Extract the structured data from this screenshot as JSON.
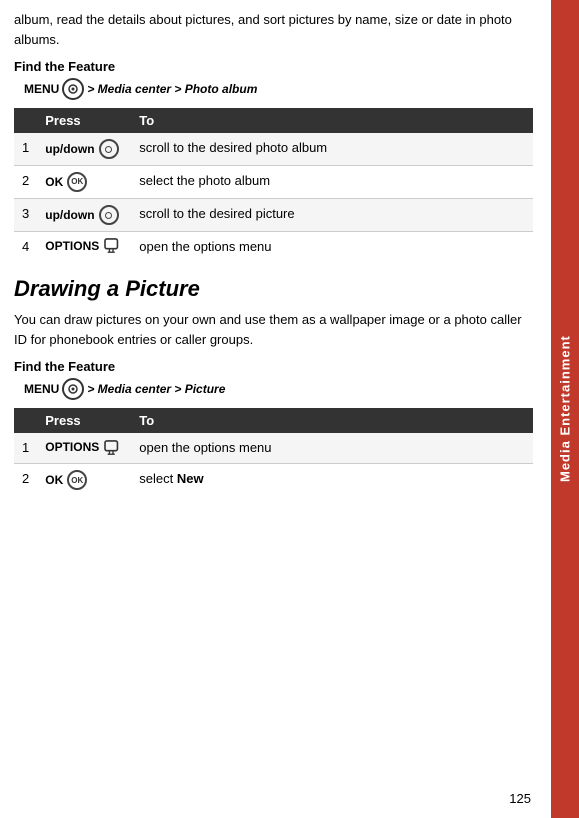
{
  "side_tab": {
    "label": "Media Entertainment"
  },
  "intro": {
    "text": "album, read the details about pictures, and sort pictures by name, size or date in photo albums."
  },
  "section1": {
    "find_feature_label": "Find the Feature",
    "menu_key": "MENU",
    "menu_path": "> Media center > Photo album",
    "table": {
      "headers": [
        "Press",
        "To"
      ],
      "rows": [
        {
          "num": "1",
          "press_label": "up/down",
          "press_type": "nav",
          "to": "scroll to the desired photo album"
        },
        {
          "num": "2",
          "press_label": "OK",
          "press_type": "ok",
          "to": "select the photo album"
        },
        {
          "num": "3",
          "press_label": "up/down",
          "press_type": "nav",
          "to": "scroll to the desired picture"
        },
        {
          "num": "4",
          "press_label": "OPTIONS",
          "press_type": "options",
          "to": "open the options menu"
        }
      ]
    }
  },
  "section2": {
    "title": "Drawing a Picture",
    "body": "You can draw pictures on your own and use them as a wallpaper image or a photo caller ID for phonebook entries or caller groups.",
    "find_feature_label": "Find the Feature",
    "menu_key": "MENU",
    "menu_path": "> Media center > Picture",
    "table": {
      "headers": [
        "Press",
        "To"
      ],
      "rows": [
        {
          "num": "1",
          "press_label": "OPTIONS",
          "press_type": "options",
          "to": "open the options menu"
        },
        {
          "num": "2",
          "press_label": "OK",
          "press_type": "ok",
          "to_prefix": "select ",
          "to_bold": "New"
        }
      ]
    }
  },
  "page_number": "125"
}
